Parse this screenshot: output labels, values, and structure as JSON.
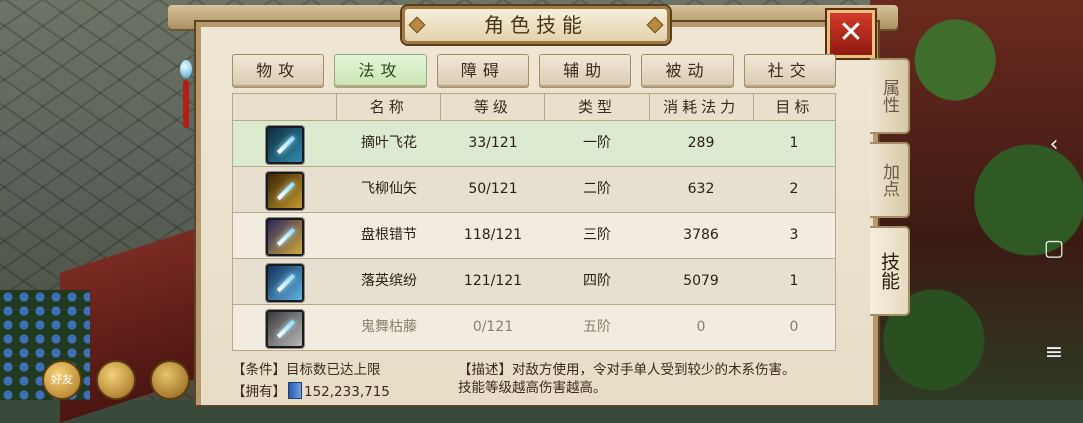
{
  "window": {
    "title": "角色技能",
    "close_glyph": "✕"
  },
  "tabs": [
    {
      "label": "物攻",
      "active": false
    },
    {
      "label": "法攻",
      "active": true
    },
    {
      "label": "障碍",
      "active": false
    },
    {
      "label": "辅助",
      "active": false
    },
    {
      "label": "被动",
      "active": false
    },
    {
      "label": "社交",
      "active": false
    }
  ],
  "table": {
    "headers": [
      "",
      "名称",
      "等级",
      "类型",
      "消耗法力",
      "目标"
    ],
    "rows": [
      {
        "name": "摘叶飞花",
        "level": "33/121",
        "type": "一阶",
        "mana": "289",
        "target": "1",
        "icon": "blade-skill-icon"
      },
      {
        "name": "飞柳仙矢",
        "level": "50/121",
        "type": "二阶",
        "mana": "632",
        "target": "2",
        "icon": "arrow-skill-icon"
      },
      {
        "name": "盘根错节",
        "level": "118/121",
        "type": "三阶",
        "mana": "3786",
        "target": "3",
        "icon": "root-skill-icon"
      },
      {
        "name": "落英缤纷",
        "level": "121/121",
        "type": "四阶",
        "mana": "5079",
        "target": "1",
        "icon": "petal-skill-icon"
      },
      {
        "name": "鬼舞枯藤",
        "level": "0/121",
        "type": "五阶",
        "mana": "0",
        "target": "0",
        "icon": "vine-skill-icon"
      }
    ]
  },
  "footer": {
    "condition": "【条件】目标数已达上限",
    "own_label": "【拥有】",
    "own_value": "152,233,715",
    "desc_line1": "【描述】对敌方使用，令对手单人受到较少的木系伤害。",
    "desc_line2": "技能等级越高伤害越高。"
  },
  "side_tabs": [
    {
      "label": "属性",
      "active": false
    },
    {
      "label": "加点",
      "active": false
    },
    {
      "label": "技能",
      "active": true
    }
  ],
  "navbar": {
    "back": "‹",
    "home": "▢",
    "menu": "≡"
  },
  "bottom_left": {
    "friend_label": "好友"
  },
  "colors": {
    "selected_row": "#dcebd0",
    "active_tab": "#c9e4b2",
    "close": "#c23222"
  }
}
